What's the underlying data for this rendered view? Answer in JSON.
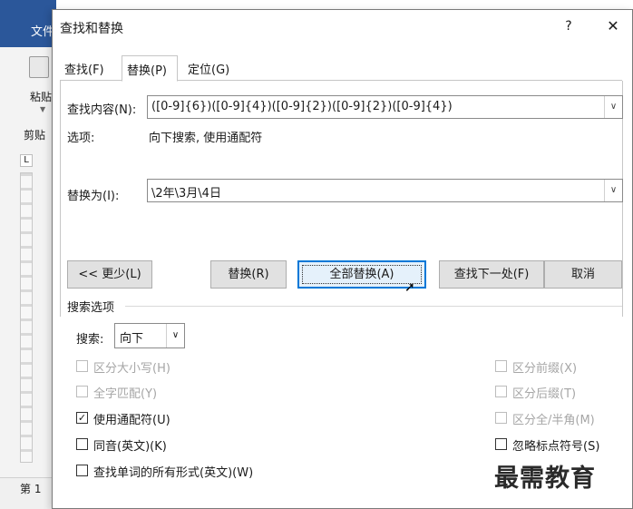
{
  "background_app": {
    "file_tab": "文件",
    "paste_label": "粘贴",
    "clipboard_label": "剪贴",
    "tab_stop": "L",
    "status_page": "第 1"
  },
  "dialog": {
    "title": "查找和替换",
    "help": "?",
    "close": "✕",
    "tabs": [
      {
        "label": "查找(F)",
        "active": false
      },
      {
        "label": "替换(P)",
        "active": true
      },
      {
        "label": "定位(G)",
        "active": false
      }
    ],
    "find": {
      "label": "查找内容(N):",
      "value": "([0-9]{6})([0-9]{4})([0-9]{2})([0-9]{2})([0-9]{4})"
    },
    "options": {
      "label": "选项:",
      "value": "向下搜索, 使用通配符"
    },
    "replace": {
      "label": "替换为(I):",
      "value": "\\2年\\3月\\4日"
    },
    "buttons": {
      "less": "<< 更少(L)",
      "replace": "替换(R)",
      "replace_all": "全部替换(A)",
      "find_next": "查找下一处(F)",
      "cancel": "取消"
    },
    "search_options": {
      "section_label": "搜索选项",
      "search_label": "搜索:",
      "search_value": "向下",
      "left_checks": [
        {
          "label": "区分大小写(H)",
          "checked": false,
          "disabled": true
        },
        {
          "label": "全字匹配(Y)",
          "checked": false,
          "disabled": true
        },
        {
          "label": "使用通配符(U)",
          "checked": true,
          "disabled": false
        },
        {
          "label": "同音(英文)(K)",
          "checked": false,
          "disabled": false
        },
        {
          "label": "查找单词的所有形式(英文)(W)",
          "checked": false,
          "disabled": false
        }
      ],
      "right_checks": [
        {
          "label": "区分前缀(X)",
          "checked": false,
          "disabled": true
        },
        {
          "label": "区分后缀(T)",
          "checked": false,
          "disabled": true
        },
        {
          "label": "区分全/半角(M)",
          "checked": false,
          "disabled": true
        },
        {
          "label": "忽略标点符号(S)",
          "checked": false,
          "disabled": false
        }
      ]
    }
  },
  "watermark": "最需教育"
}
